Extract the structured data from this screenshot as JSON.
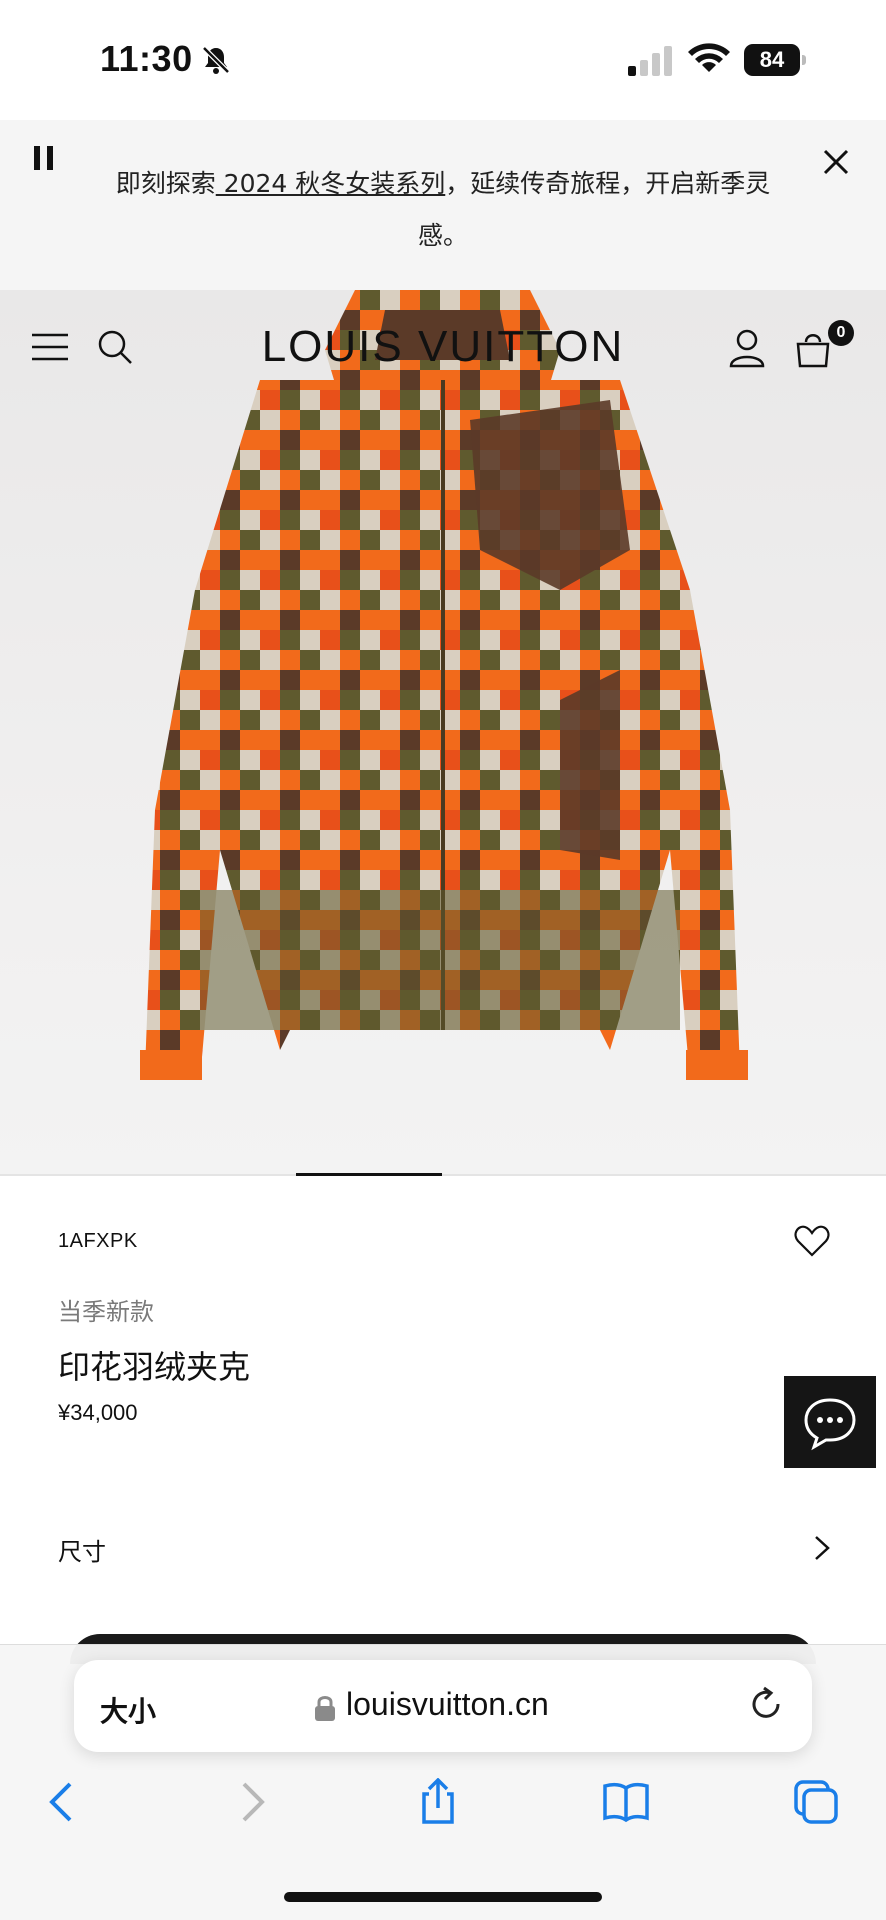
{
  "status_bar": {
    "time": "11:30",
    "battery": "84",
    "icons": [
      "bell-slash-icon",
      "signal-icon",
      "wifi-icon",
      "battery-icon"
    ]
  },
  "banner": {
    "text_before": "即刻探索",
    "link_text": " 2024 秋冬女装系列",
    "text_after": "，延续传奇旅程，开启新季灵感。"
  },
  "header": {
    "logo": "LOUIS VUITTON",
    "bag_count": "0"
  },
  "product": {
    "sku": "1AFXPK",
    "tag": "当季新款",
    "name": "印花羽绒夹克",
    "price": "¥34,000",
    "size_label": "尺寸",
    "colors": {
      "orange": "#f26a1b",
      "brown": "#5b3a28",
      "olive": "#5f5a2e",
      "beige": "#d9cfc0"
    }
  },
  "browser": {
    "aa": "大小",
    "url": "louisvuitton.cn"
  }
}
